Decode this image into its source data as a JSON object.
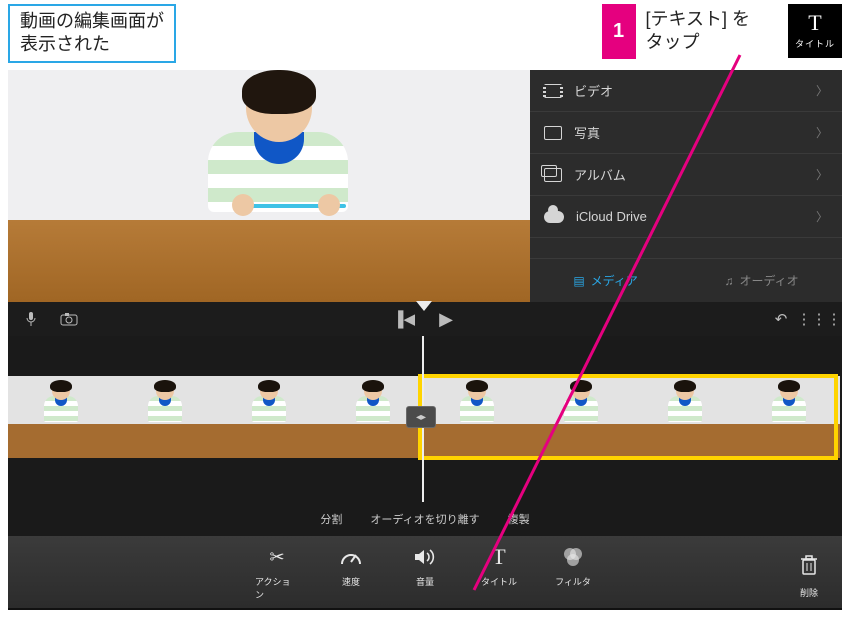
{
  "annotations": {
    "left_callout": "動画の編集画面が\n表示された",
    "step_number": "1",
    "step_text": "[テキスト] を\nタップ",
    "float_icon_glyph": "T",
    "float_icon_label": "タイトル"
  },
  "media_panel": {
    "items": [
      {
        "label": "ビデオ",
        "icon": "film"
      },
      {
        "label": "写真",
        "icon": "photo"
      },
      {
        "label": "アルバム",
        "icon": "album"
      },
      {
        "label": "iCloud Drive",
        "icon": "cloud"
      }
    ],
    "tabs": {
      "media": "メディア",
      "audio": "オーディオ"
    }
  },
  "action_row": {
    "split": "分割",
    "detach_audio": "オーディオを切り離す",
    "duplicate": "複製"
  },
  "bottom_tools": {
    "action": "アクション",
    "speed": "速度",
    "volume": "音量",
    "title": "タイトル",
    "filter": "フィルタ",
    "delete": "削除"
  }
}
